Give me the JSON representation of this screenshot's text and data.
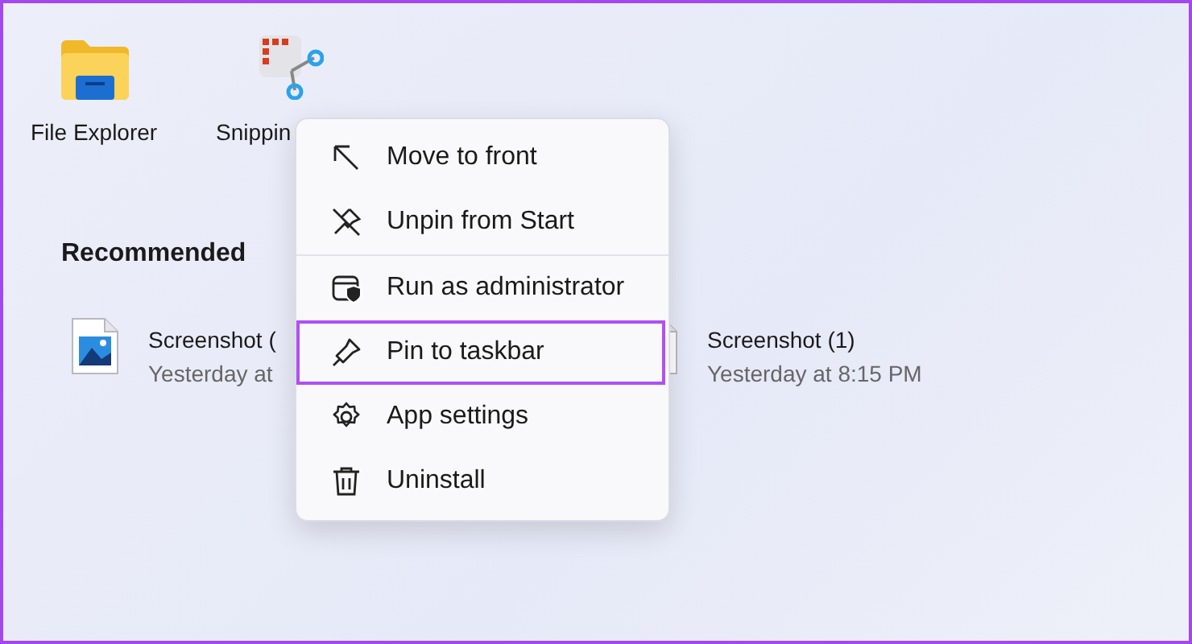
{
  "pinned": [
    {
      "label": "File Explorer"
    },
    {
      "label": "Snippin"
    }
  ],
  "recommended": {
    "title": "Recommended",
    "items": [
      {
        "name": "Screenshot (",
        "time": "Yesterday at"
      },
      {
        "name": "Screenshot (1)",
        "time": "Yesterday at 8:15 PM"
      }
    ]
  },
  "context_menu": {
    "groups": [
      [
        {
          "label": "Move to front",
          "highlighted": false
        },
        {
          "label": "Unpin from Start",
          "highlighted": false
        }
      ],
      [
        {
          "label": "Run as administrator",
          "highlighted": false
        },
        {
          "label": "Pin to taskbar",
          "highlighted": true
        },
        {
          "label": "App settings",
          "highlighted": false
        },
        {
          "label": "Uninstall",
          "highlighted": false
        }
      ]
    ]
  }
}
